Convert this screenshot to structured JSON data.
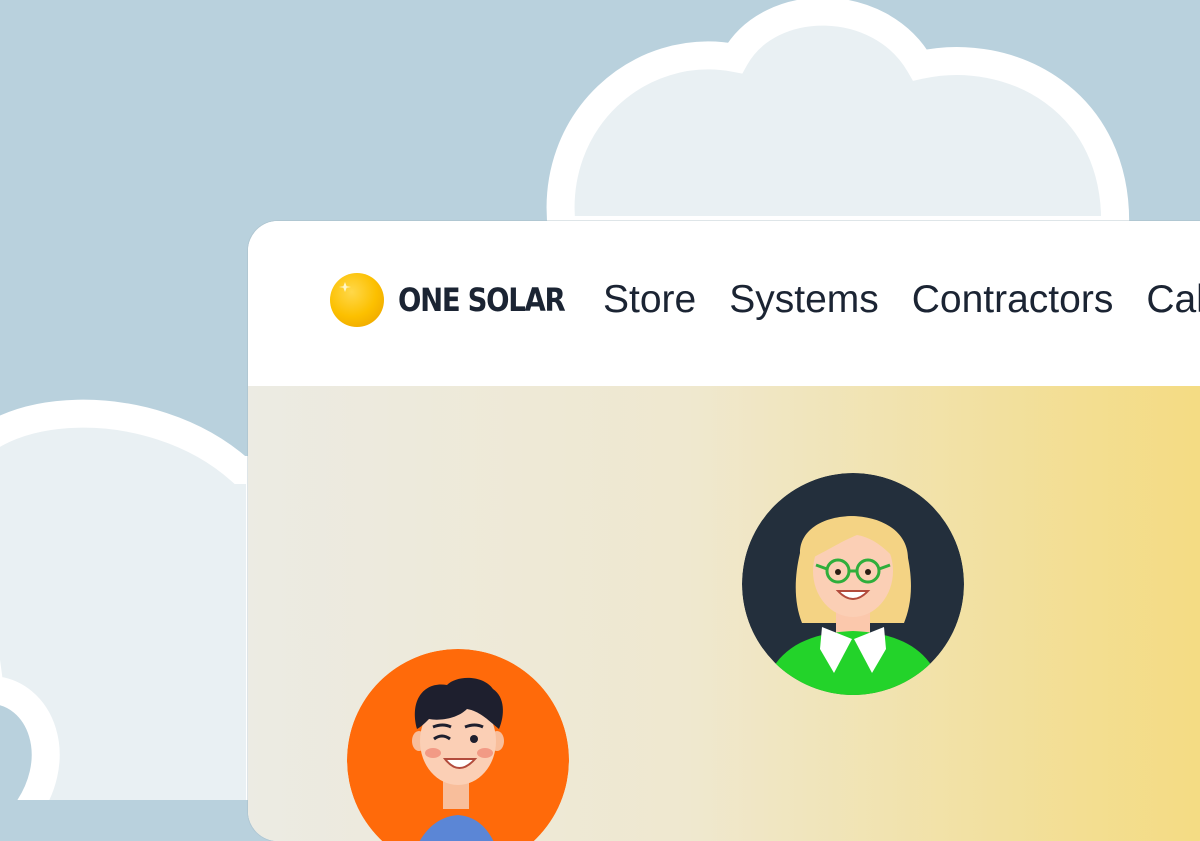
{
  "header": {
    "brand": "ONE SOLAR",
    "logo_icon": "sun-icon"
  },
  "nav": {
    "items": [
      {
        "label": "Store"
      },
      {
        "label": "Systems"
      },
      {
        "label": "Contractors"
      },
      {
        "label": "Cal"
      }
    ]
  },
  "hero": {
    "avatars": [
      {
        "name": "woman-with-glasses-avatar",
        "background": "#232f3c"
      },
      {
        "name": "winking-man-avatar",
        "background": "#ff6a0a"
      }
    ]
  },
  "colors": {
    "page_background": "#b9d1dd",
    "cloud_fill": "#e9f0f3",
    "cloud_outline": "#ffffff",
    "brand_yellow": "#fcc000",
    "text_dark": "#1b2433"
  }
}
